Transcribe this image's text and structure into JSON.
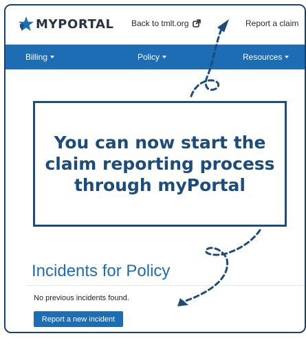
{
  "header": {
    "logo_text": "MYPORTAL",
    "back_link": "Back to tmlt.org",
    "report_link": "Report a claim"
  },
  "nav": {
    "items": [
      {
        "label": "Billing"
      },
      {
        "label": "Policy"
      },
      {
        "label": "Resources"
      }
    ]
  },
  "callout": {
    "text": "You can now start the claim reporting process through myPortal"
  },
  "incidents": {
    "title": "Incidents for Policy",
    "empty_message": "No previous incidents found.",
    "report_button": "Report a new incident"
  },
  "colors": {
    "nav_bar": "#1d6db4",
    "callout_border": "#1b4c7b",
    "frame": "#1b3f66",
    "star": "#1d6db4"
  },
  "icons": {
    "logo": "star-icon",
    "external_link": "external-link-icon",
    "caret": "chevron-down-icon"
  }
}
